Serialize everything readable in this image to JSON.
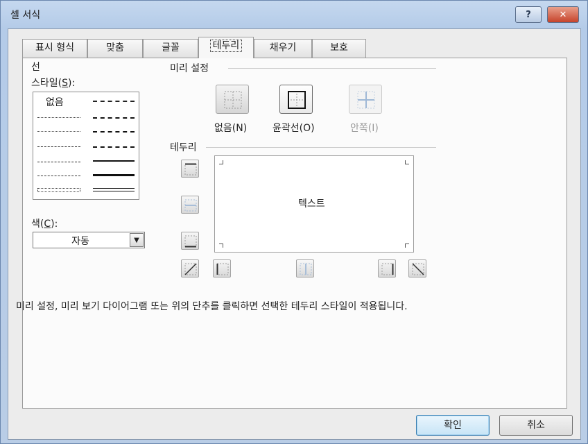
{
  "window": {
    "title": "셀 서식",
    "help_label": "?",
    "close_label": "✕"
  },
  "tabs": [
    {
      "label": "표시 형식"
    },
    {
      "label": "맞춤"
    },
    {
      "label": "글꼴"
    },
    {
      "label": "테두리",
      "active": true
    },
    {
      "label": "채우기"
    },
    {
      "label": "보호"
    }
  ],
  "line_group": {
    "title": "선",
    "style_label": "스타일(",
    "style_key": "S",
    "style_label_end": "):",
    "none_label": "없음",
    "color_label": "색(",
    "color_key": "C",
    "color_label_end": "):",
    "color_value": "자동"
  },
  "presets": {
    "title": "미리 설정",
    "none": "없음(N)",
    "outline": "윤곽선(O)",
    "inside": "안쪽(I)"
  },
  "border": {
    "title": "테두리",
    "preview_text": "텍스트"
  },
  "hint": "미리 설정, 미리 보기 다이어그램 또는 위의 단추를 클릭하면 선택한 테두리 스타일이 적용됩니다.",
  "buttons": {
    "ok": "확인",
    "cancel": "취소"
  },
  "colors": {
    "accent": "#3c7fb1",
    "close": "#c6432b",
    "title_bg": "#b4cbe8"
  }
}
